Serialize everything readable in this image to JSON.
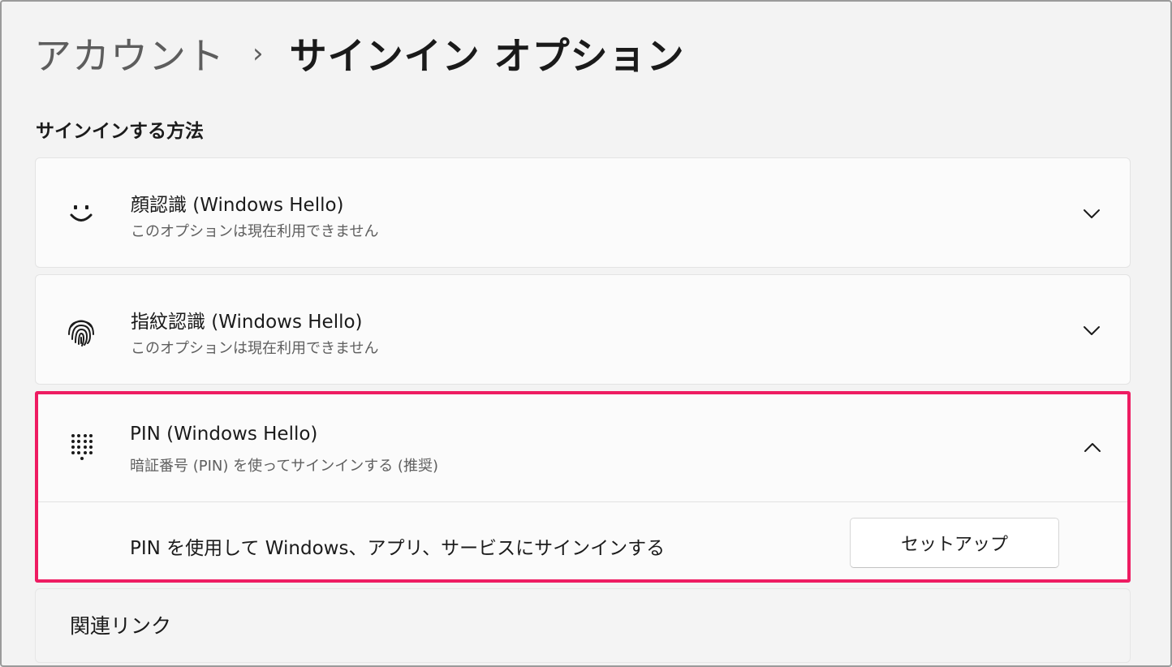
{
  "breadcrumb": {
    "parent": "アカウント",
    "separator": "›",
    "current": "サインイン オプション"
  },
  "section": {
    "title": "サインインする方法"
  },
  "methods": [
    {
      "icon": "smiley-face-icon",
      "title": "顔認識 (Windows Hello)",
      "subtitle": "このオプションは現在利用できません",
      "expanded": false
    },
    {
      "icon": "fingerprint-icon",
      "title": "指紋認識 (Windows Hello)",
      "subtitle": "このオプションは現在利用できません",
      "expanded": false
    },
    {
      "icon": "pin-keypad-icon",
      "title": "PIN (Windows Hello)",
      "subtitle": "暗証番号 (PIN) を使ってサインインする (推奨)",
      "expanded": true,
      "detail_text": "PIN を使用して Windows、アプリ、サービスにサインインする",
      "button_label": "セットアップ"
    }
  ],
  "related": {
    "label": "関連リンク"
  },
  "colors": {
    "highlight": "#ee1c62",
    "background": "#f3f3f3",
    "card": "#fbfbfb"
  }
}
